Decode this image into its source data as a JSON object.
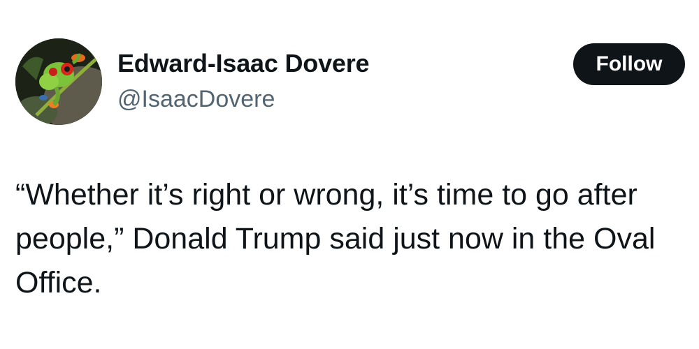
{
  "author": {
    "display_name": "Edward-Isaac Dovere",
    "handle": "@IsaacDovere",
    "avatar_icon": "tree-frog-avatar"
  },
  "actions": {
    "follow_label": "Follow"
  },
  "tweet": {
    "text": "“Whether it’s right or wrong, it’s time to go after people,” Donald Trump said just now in the Oval Office."
  },
  "colors": {
    "primary_text": "#0f1419",
    "secondary_text": "#536471",
    "follow_button_bg": "#0f1419",
    "follow_button_text": "#ffffff",
    "background": "#ffffff"
  }
}
